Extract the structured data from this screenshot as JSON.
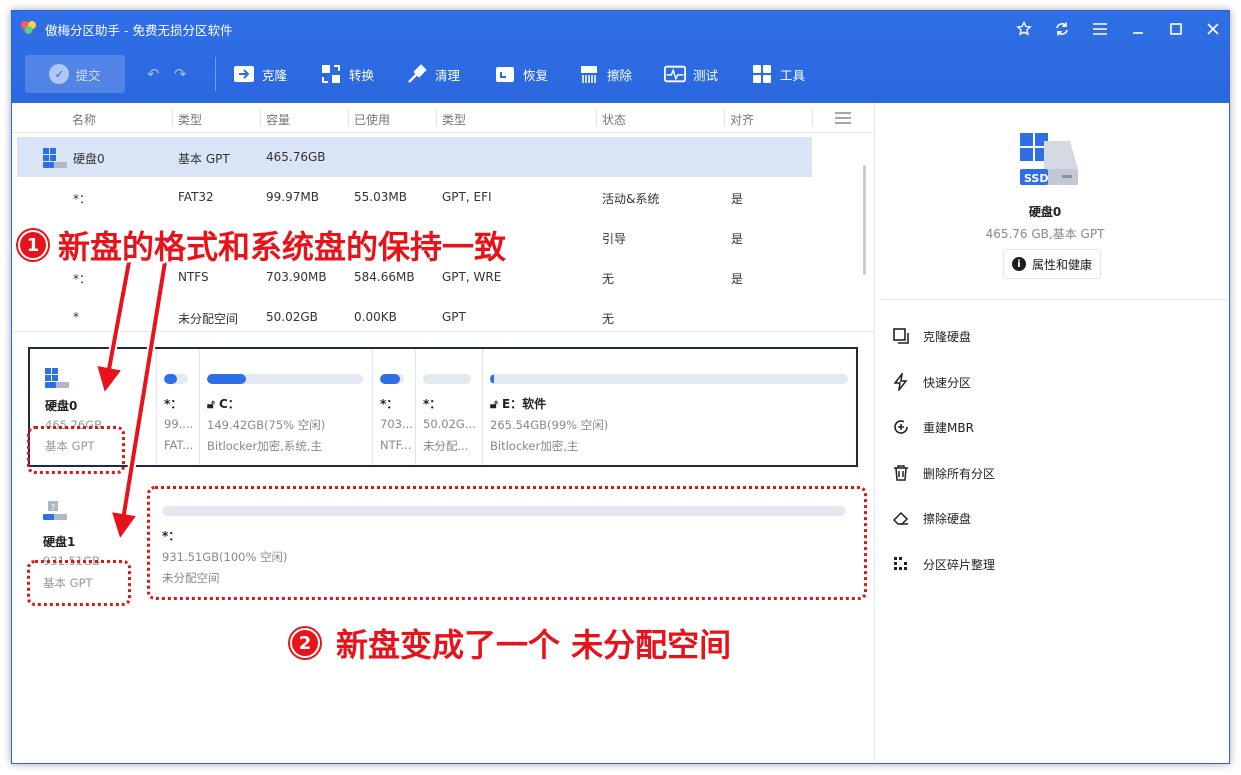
{
  "app": {
    "title": "傲梅分区助手 - 免费无损分区软件"
  },
  "window_controls": [
    "star-icon",
    "refresh-icon",
    "menu-icon",
    "minimize-icon",
    "maximize-icon",
    "close-icon"
  ],
  "toolbar": {
    "submit_label": "提交",
    "items": [
      {
        "label": "克隆",
        "icon": "clone-icon"
      },
      {
        "label": "转换",
        "icon": "convert-icon"
      },
      {
        "label": "清理",
        "icon": "cleanup-icon"
      },
      {
        "label": "恢复",
        "icon": "recover-icon"
      },
      {
        "label": "擦除",
        "icon": "wipe-icon"
      },
      {
        "label": "测试",
        "icon": "test-icon"
      },
      {
        "label": "工具",
        "icon": "tools-icon"
      }
    ]
  },
  "table": {
    "headers": [
      "名称",
      "类型",
      "容量",
      "已使用",
      "类型",
      "状态",
      "对齐"
    ],
    "rows": [
      {
        "name": "硬盘0",
        "type": "基本 GPT",
        "capacity": "465.76GB",
        "used": "",
        "fs": "",
        "status": "",
        "align": ""
      },
      {
        "name": "*：",
        "type": "FAT32",
        "capacity": "99.97MB",
        "used": "55.03MB",
        "fs": "GPT, EFI",
        "status": "活动&系统",
        "align": "是"
      },
      {
        "name": "",
        "type": "",
        "capacity": "",
        "used": "",
        "fs": "",
        "status": "引导",
        "align": "是"
      },
      {
        "name": "*：",
        "type": "NTFS",
        "capacity": "703.90MB",
        "used": "584.66MB",
        "fs": "GPT, WRE",
        "status": "无",
        "align": "是"
      },
      {
        "name": "*",
        "type": "未分配空间",
        "capacity": "50.02GB",
        "used": "0.00KB",
        "fs": "GPT",
        "status": "无",
        "align": ""
      }
    ]
  },
  "disks": [
    {
      "name": "硬盘0",
      "size": "465.76GB",
      "type": "基本 GPT",
      "partitions": [
        {
          "name": "*：",
          "size": "99....",
          "desc": "FAT...",
          "fill": 0.55
        },
        {
          "name": "C：",
          "size": "149.42GB(75% 空闲)",
          "desc": "Bitlocker加密,系统,主",
          "fill": 0.25,
          "lock": true
        },
        {
          "name": "*：",
          "size": "703...",
          "desc": "NTF...",
          "fill": 0.83
        },
        {
          "name": "*：",
          "size": "50.02G...",
          "desc": "未分配...",
          "fill": 0
        },
        {
          "name": "E：软件",
          "size": "265.54GB(99% 空闲)",
          "desc": "Bitlocker加密,主",
          "fill": 0.01,
          "lock": true
        }
      ]
    },
    {
      "name": "硬盘1",
      "size": "931.51GB",
      "type": "基本 GPT",
      "partitions": [
        {
          "name": "*：",
          "size": "931.51GB(100% 空闲)",
          "desc": "未分配空间",
          "fill": 0
        }
      ]
    }
  ],
  "right_panel": {
    "disk_name": "硬盘0",
    "disk_info": "465.76 GB,基本 GPT",
    "properties_label": "属性和健康",
    "actions": [
      {
        "label": "克隆硬盘",
        "icon": "clone-disk-icon"
      },
      {
        "label": "快速分区",
        "icon": "quick-partition-icon"
      },
      {
        "label": "重建MBR",
        "icon": "rebuild-mbr-icon"
      },
      {
        "label": "删除所有分区",
        "icon": "trash-icon"
      },
      {
        "label": "擦除硬盘",
        "icon": "eraser-icon"
      },
      {
        "label": "分区碎片整理",
        "icon": "defrag-icon"
      }
    ]
  },
  "annotations": {
    "callout1_number": "1",
    "callout1_text": "新盘的格式和系统盘的保持一致",
    "callout2_number": "2",
    "callout2_text": "新盘变成了一个  未分配空间"
  },
  "colors": {
    "accent": "#2f6fe6",
    "annotation": "#e8131a",
    "selected_row": "#d9e4f6"
  }
}
